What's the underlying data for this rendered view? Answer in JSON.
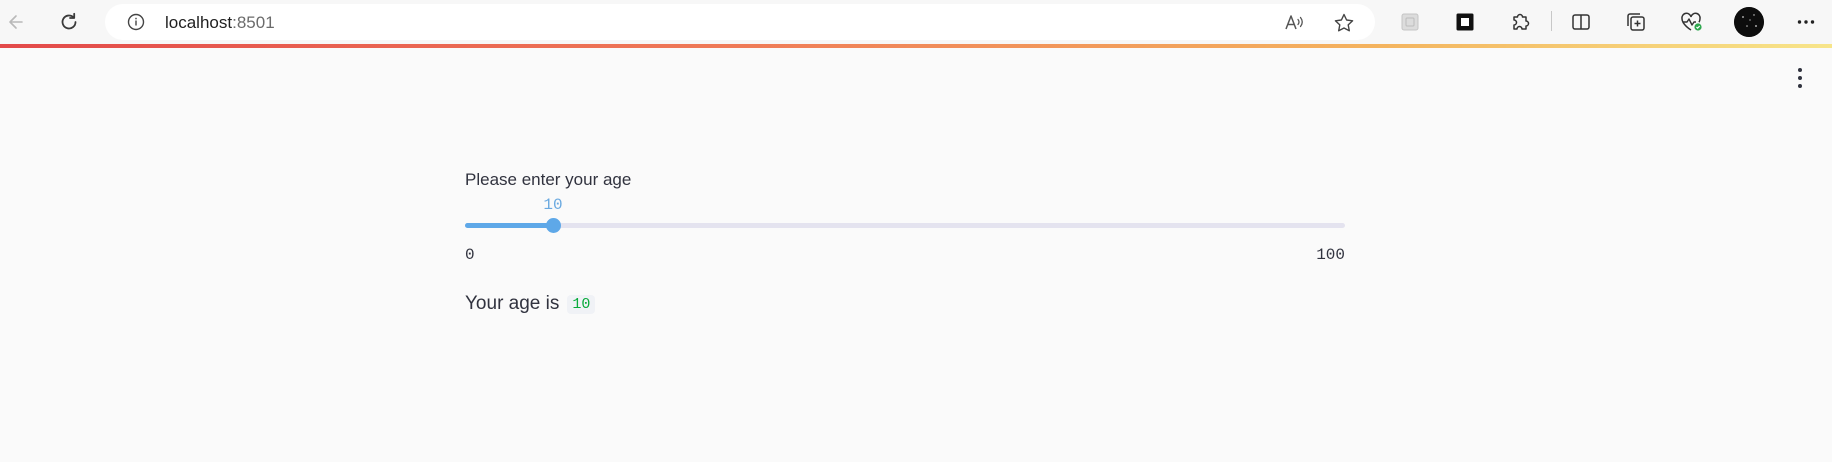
{
  "browser": {
    "url_host": "localhost",
    "url_port": ":8501",
    "icons": {
      "back": "back-arrow-icon",
      "reload": "reload-icon",
      "info": "info-icon",
      "read_aloud": "read-aloud-icon",
      "favorite": "star-icon",
      "extension_gray": "extension-placeholder-icon",
      "collections_frame": "frame-icon",
      "extensions": "puzzle-icon",
      "split_screen": "split-screen-icon",
      "collections": "collections-icon",
      "browser_essentials": "heart-pulse-icon",
      "profile": "avatar",
      "more": "more-horizontal-icon"
    },
    "loading_bar_colors": [
      "#e34a4a",
      "#ef7a57",
      "#f4b35e",
      "#f7e58a"
    ]
  },
  "app": {
    "slider": {
      "label": "Please enter your age",
      "value": 10,
      "value_text": "10",
      "min": 0,
      "min_text": "0",
      "max": 100,
      "max_text": "100",
      "accent_color": "#5ea8e8"
    },
    "result": {
      "prefix": "Your age is",
      "value": "10",
      "value_color": "#09ab3b"
    },
    "menu_icon": "more-vertical-icon"
  }
}
